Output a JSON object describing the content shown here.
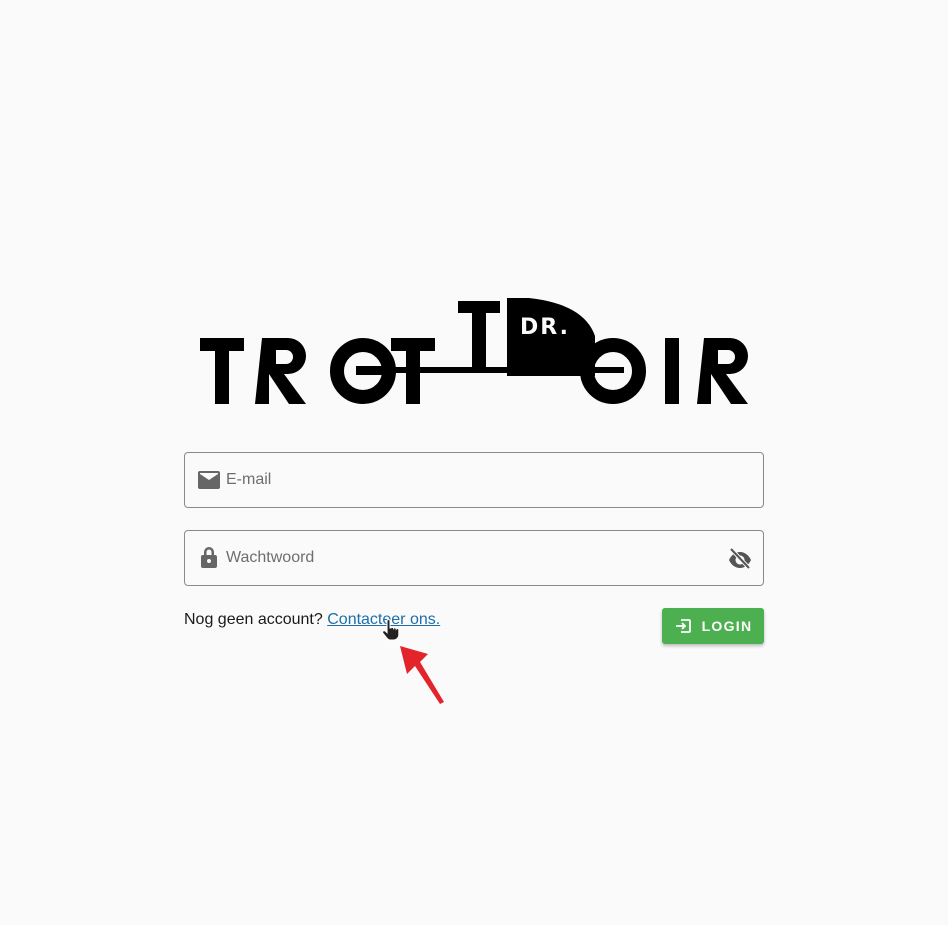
{
  "logo": {
    "wordmark": "TROTTOIR",
    "badge": "DR.",
    "alt": "Dr. Trottoir logo"
  },
  "form": {
    "email": {
      "placeholder": "E-mail",
      "value": "",
      "icon": "envelope-icon"
    },
    "password": {
      "placeholder": "Wachtwoord",
      "value": "",
      "icon": "lock-icon",
      "toggle_icon": "eye-off-icon"
    },
    "signup_prompt": "Nog geen account?",
    "signup_link": "Contacteer ons.",
    "login_label": "LOGIN",
    "login_icon": "login-icon"
  },
  "colors": {
    "background": "#fafafa",
    "primary_button": "#4caf50",
    "link": "#1d6fa8",
    "annotation_arrow": "#e3242b"
  }
}
